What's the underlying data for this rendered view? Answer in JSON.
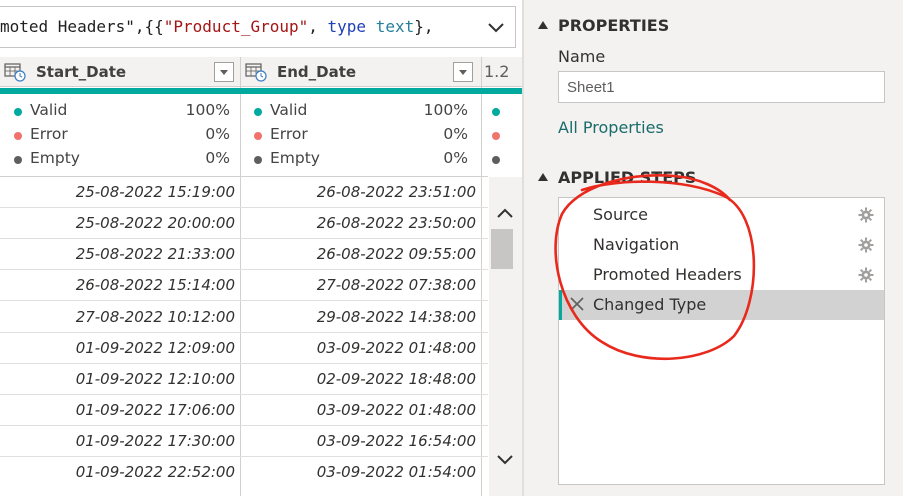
{
  "formula_bar": {
    "prefix": "moted Headers\",{{",
    "string": "\"Product_Group\"",
    "sep": ", ",
    "kw": "type",
    "space": " ",
    "typ": "text",
    "suffix": "},"
  },
  "columns": [
    {
      "name": "Start_Date",
      "type_icon": "datetime-icon"
    },
    {
      "name": "End_Date",
      "type_icon": "datetime-icon"
    },
    {
      "name": "1.2",
      "type_icon": "decimal-type"
    }
  ],
  "quality": {
    "labels": [
      "Valid",
      "Error",
      "Empty"
    ],
    "colors": [
      "#01a99f",
      "#f0726a",
      "#605e5c"
    ],
    "start_date": [
      "100%",
      "0%",
      "0%"
    ],
    "end_date": [
      "100%",
      "0%",
      "0%"
    ]
  },
  "rows": [
    {
      "start": "25-08-2022 15:19:00",
      "end": "26-08-2022 23:51:00"
    },
    {
      "start": "25-08-2022 20:00:00",
      "end": "26-08-2022 23:50:00"
    },
    {
      "start": "25-08-2022 21:33:00",
      "end": "26-08-2022 09:55:00"
    },
    {
      "start": "26-08-2022 15:14:00",
      "end": "27-08-2022 07:38:00"
    },
    {
      "start": "27-08-2022 10:12:00",
      "end": "29-08-2022 14:38:00"
    },
    {
      "start": "01-09-2022 12:09:00",
      "end": "03-09-2022 01:48:00"
    },
    {
      "start": "01-09-2022 12:10:00",
      "end": "02-09-2022 18:48:00"
    },
    {
      "start": "01-09-2022 17:06:00",
      "end": "03-09-2022 01:48:00"
    },
    {
      "start": "01-09-2022 17:30:00",
      "end": "03-09-2022 16:54:00"
    },
    {
      "start": "01-09-2022 22:52:00",
      "end": "03-09-2022 01:54:00"
    }
  ],
  "properties": {
    "heading": "PROPERTIES",
    "name_label": "Name",
    "name_value": "Sheet1",
    "all_properties_link": "All Properties"
  },
  "applied_steps": {
    "heading": "APPLIED STEPS",
    "steps": [
      {
        "label": "Source",
        "has_gear": true,
        "selected": false
      },
      {
        "label": "Navigation",
        "has_gear": true,
        "selected": false
      },
      {
        "label": "Promoted Headers",
        "has_gear": true,
        "selected": false
      },
      {
        "label": "Changed Type",
        "has_gear": false,
        "selected": true
      }
    ]
  },
  "colors": {
    "accent_teal": "#01a99f",
    "link": "#1b6b6b",
    "annotation_red": "#e8291c"
  }
}
